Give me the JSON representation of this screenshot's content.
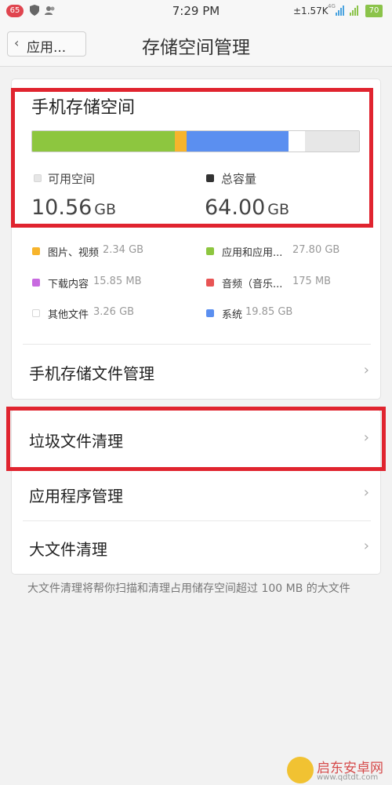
{
  "status_bar": {
    "notification_count": "65",
    "time": "7:29 PM",
    "net_speed": "±1.57K",
    "network_type": "4G",
    "battery": "70"
  },
  "header": {
    "back_label": "应用...",
    "title": "存储空间管理"
  },
  "storage": {
    "title": "手机存储空间",
    "available_label": "可用空间",
    "available_value": "10.56",
    "available_unit": "GB",
    "total_label": "总容量",
    "total_value": "64.00",
    "total_unit": "GB",
    "bar_segments": [
      {
        "name": "应用和应用...",
        "value_gb": 27.8,
        "color": "#8dc63f"
      },
      {
        "name": "图片、视频",
        "value_gb": 2.34,
        "color": "#f7b42c"
      },
      {
        "name": "系统",
        "value_gb": 19.85,
        "color": "#5b8ff0"
      },
      {
        "name": "其他文件",
        "value_gb": 3.26,
        "color": "#ffffff"
      },
      {
        "name": "可用空间",
        "value_gb": 10.56,
        "color": "#e7e7e7"
      }
    ],
    "legend": [
      {
        "name": "图片、视频",
        "size": "2.34 GB",
        "color": "#f7b42c"
      },
      {
        "name": "应用和应用...",
        "size": "27.80 GB",
        "color": "#8dc63f"
      },
      {
        "name": "下载内容",
        "size": "15.85 MB",
        "color": "#c86ae0"
      },
      {
        "name": "音频（音乐...",
        "size": "175 MB",
        "color": "#e85454"
      },
      {
        "name": "其他文件",
        "size": "3.26 GB",
        "color": "#ffffff"
      },
      {
        "name": "系统",
        "size": "19.85 GB",
        "color": "#5b8ff0"
      }
    ]
  },
  "menu": {
    "file_manager": "手机存储文件管理",
    "junk_cleanup": "垃圾文件清理",
    "app_manager": "应用程序管理",
    "large_file_cleanup": "大文件清理"
  },
  "footnote": "大文件清理将帮你扫描和清理占用储存空间超过 100 MB 的大文件",
  "watermark": {
    "name": "启东安卓网",
    "url": "www.qdtdt.com"
  },
  "colors": {
    "highlight": "#e0242f",
    "available_dot": "#e6e6e6",
    "total_dot": "#333333"
  }
}
